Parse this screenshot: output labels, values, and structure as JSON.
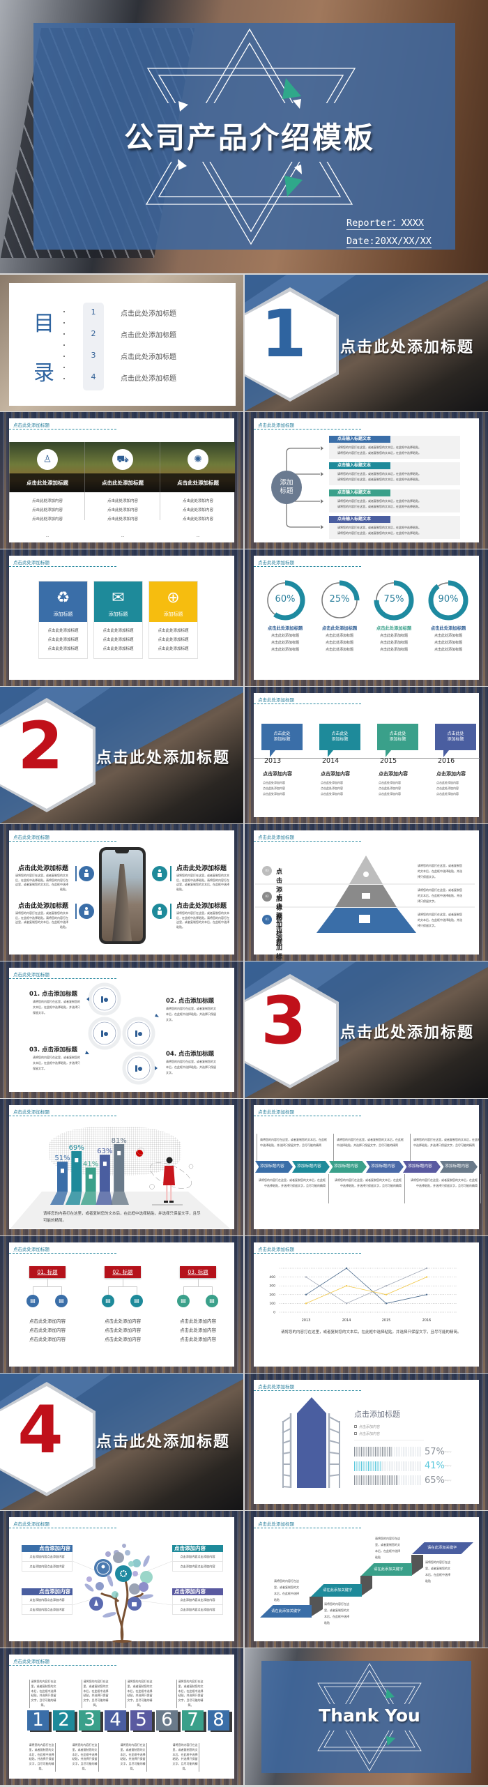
{
  "colors": {
    "blue": "#3a6ea8",
    "teal": "#1e8a9a",
    "green": "#3aa08a",
    "indigo": "#4a5ea0",
    "violet": "#5a5aa0",
    "slate": "#6a7a8a",
    "yellow": "#f6bd0f",
    "red": "#b5121b",
    "header": "#2a7f9c"
  },
  "cover": {
    "title": "公司产品介绍模板",
    "reporter": "Reporter：XXXX",
    "date": "Date:20XX/XX/XX"
  },
  "common": {
    "header": "点击此处添加标题"
  },
  "toc": {
    "char_1": "目",
    "char_2": "录",
    "items": [
      {
        "num": "1",
        "label": "点击此处添加标题"
      },
      {
        "num": "2",
        "label": "点击此处添加标题"
      },
      {
        "num": "3",
        "label": "点击此处添加标题"
      },
      {
        "num": "4",
        "label": "点击此处添加标题"
      }
    ]
  },
  "sections": [
    {
      "num": "1",
      "title": "点击此处添加标题",
      "color": "#2f64a0"
    },
    {
      "num": "2",
      "title": "点击此处添加标题",
      "color": "#c0101a"
    },
    {
      "num": "3",
      "title": "点击此处添加标题",
      "color": "#c0101a"
    },
    {
      "num": "4",
      "title": "点击此处添加标题",
      "color": "#c0101a"
    }
  ],
  "features": {
    "columns": [
      {
        "icon": "person-globe-icon",
        "glyph": "♙",
        "title": "点击此处添加标题",
        "lines": [
          "点击此处添加内容",
          "点击此处添加内容",
          "点击此处添加内容"
        ],
        "more": "..."
      },
      {
        "icon": "car-icon",
        "glyph": "⛟",
        "title": "点击此处添加标题",
        "lines": [
          "点击此处添加内容",
          "点击此处添加内容",
          "点击此处添加内容"
        ],
        "more": "..."
      },
      {
        "icon": "network-icon",
        "glyph": "✺",
        "title": "点击此处添加标题",
        "lines": [
          "点击此处添加内容",
          "点击此处添加内容",
          "点击此处添加内容"
        ],
        "more": "..."
      }
    ]
  },
  "branch": {
    "center_1": "添加",
    "center_2": "标题",
    "items": [
      {
        "title": "点击输入标题文本",
        "color": "#3a6ea8",
        "lines": [
          "请将您的内容打在这里，或者复制您的文本后，在此框中选择粘贴。",
          "请将您的内容打在这里，或者复制您的文本后，在此框中选择粘贴。"
        ]
      },
      {
        "title": "点击输入标题文本",
        "color": "#1e8a9a",
        "lines": [
          "请将您的内容打在这里，或者复制您的文本后，在此框中选择粘贴。",
          "请将您的内容打在这里，或者复制您的文本后，在此框中选择粘贴。"
        ]
      },
      {
        "title": "点击输入标题文本",
        "color": "#3aa08a",
        "lines": [
          "请将您的内容打在这里，或者复制您的文本后，在此框中选择粘贴。",
          "请将您的内容打在这里，或者复制您的文本后，在此框中选择粘贴。"
        ]
      },
      {
        "title": "点击输入标题文本",
        "color": "#4a5ea0",
        "lines": [
          "请将您的内容打在这里，或者复制您的文本后，在此框中选择粘贴。",
          "请将您的内容打在这里，或者复制您的文本后，在此框中选择粘贴。"
        ]
      }
    ]
  },
  "cards": [
    {
      "label": "添加标题",
      "icon": "recycle-icon",
      "glyph": "♻",
      "color": "#3a6ea8",
      "lines": [
        "点击此处添加标题",
        "点击此处添加标题",
        "点击此处添加标题"
      ]
    },
    {
      "label": "添加标题",
      "icon": "mail-icon",
      "glyph": "✉",
      "color": "#1e8a9a",
      "lines": [
        "点击此处添加标题",
        "点击此处添加标题",
        "点击此处添加标题"
      ]
    },
    {
      "label": "添加标题",
      "icon": "globe-icon",
      "glyph": "⊕",
      "color": "#f6bd0f",
      "lines": [
        "点击此处添加标题",
        "点击此处添加标题",
        "点击此处添加标题"
      ]
    }
  ],
  "rings": [
    {
      "value": 60,
      "label": "60%",
      "title": "点击此处添加标题",
      "title_color": "#2f5e94",
      "lines": [
        "点击此处添加标题",
        "点击此处添加标题",
        "点击此处添加标题"
      ]
    },
    {
      "value": 25,
      "label": "25%",
      "title": "点击此处添加标题",
      "title_color": "#2f5e94",
      "lines": [
        "点击此处添加标题",
        "点击此处添加标题",
        "点击此处添加标题"
      ]
    },
    {
      "value": 75,
      "label": "75%",
      "title": "点击此处添加标题",
      "title_color": "#3aa08a",
      "lines": [
        "点击此处添加标题",
        "点击此处添加标题",
        "点击此处添加标题"
      ]
    },
    {
      "value": 90,
      "label": "90%",
      "title": "点击此处添加标题",
      "title_color": "#2f5e94",
      "lines": [
        "点击此处添加标题",
        "点击此处添加标题",
        "点击此处添加标题"
      ]
    }
  ],
  "timeline": [
    {
      "box_1": "点击此处",
      "box_2": "添加标题",
      "year": "2013",
      "title": "点击添加内容",
      "color": "#3a6ea8",
      "lines": [
        "点击此处添加内容",
        "点击此处添加内容",
        "点击此处添加内容"
      ]
    },
    {
      "box_1": "点击此处",
      "box_2": "添加标题",
      "year": "2014",
      "title": "点击添加内容",
      "color": "#1e8a9a",
      "lines": [
        "点击此处添加内容",
        "点击此处添加内容",
        "点击此处添加内容"
      ]
    },
    {
      "box_1": "点击此处",
      "box_2": "添加标题",
      "year": "2015",
      "title": "点击添加内容",
      "color": "#3aa08a",
      "lines": [
        "点击此处添加内容",
        "点击此处添加内容",
        "点击此处添加内容"
      ]
    },
    {
      "box_1": "点击此处",
      "box_2": "添加标题",
      "year": "2016",
      "title": "点击添加内容",
      "color": "#4a5ea0",
      "lines": [
        "点击此处添加内容",
        "点击此处添加内容",
        "点击此处添加内容"
      ]
    }
  ],
  "phone": {
    "items": [
      {
        "title": "点击此处添加标题",
        "text": "请将您的内容打在这里，或者复制您的文本后，在此框中选择粘贴。请将您的内容打在这里，或者复制您的文本后，在此框中选择粘贴。"
      },
      {
        "title": "点击此处添加标题",
        "text": "请将您的内容打在这里，或者复制您的文本后，在此框中选择粘贴。请将您的内容打在这里，或者复制您的文本后，在此框中选择粘贴。"
      },
      {
        "title": "点击此处添加标题",
        "text": "请将您的内容打在这里，或者复制您的文本后，在此框中选择粘贴。请将您的内容打在这里，或者复制您的文本后，在此框中选择粘贴。"
      },
      {
        "title": "点击此处添加标题",
        "text": "请将您的内容打在这里，或者复制您的文本后，在此框中选择粘贴。请将您的内容打在这里，或者复制您的文本后，在此框中选择粘贴。"
      }
    ]
  },
  "pyramid": {
    "items": [
      {
        "num": "03",
        "title": "点击添加标题",
        "color": "#bdbdbd",
        "text": "请将您的内容打在这里，或者复制您的文本后，在此框中选择粘贴，并选择只保留文字。"
      },
      {
        "num": "02",
        "title": "点击添加标题",
        "color": "#8a8a8a",
        "text": "请将您的内容打在这里，或者复制您的文本后，在此框中选择粘贴，并选择只保留文字。"
      },
      {
        "num": "01",
        "title": "点击添加标题",
        "color": "#3a6ea8",
        "text": "请将您的内容打在这里，或者复制您的文本后，在此框中选择粘贴，并选择只保留文字。"
      }
    ]
  },
  "circles": {
    "items": [
      {
        "title": "01. 点击添加标题",
        "text": "请将您的内容打在这里，或者复制您的文本后，在此框中选择粘贴，并选择只保留文字。"
      },
      {
        "title": "02. 点击添加标题",
        "text": "请将您的内容打在这里，或者复制您的文本后，在此框中选择粘贴，并选择只保留文字。"
      },
      {
        "title": "03. 点击添加标题",
        "text": "请将您的内容打在这里，或者复制您的文本后，在此框中选择粘贴，并选择只保留文字。"
      },
      {
        "title": "04. 点击添加标题",
        "text": "请将您的内容打在这里，或者复制您的文本后，在此框中选择粘贴，并选择只保留文字。"
      }
    ]
  },
  "bars_slide": {
    "text": "请将您的内容打在这里，或者复制您的文本后，在此框中选择粘贴，并选择只保留文字，且尽可能的精简。"
  },
  "process": {
    "steps": [
      {
        "label": "添加标题内容",
        "color": "#3a6ea8"
      },
      {
        "label": "添加标题内容",
        "color": "#1e8a9a"
      },
      {
        "label": "添加标题内容",
        "color": "#3aa08a"
      },
      {
        "label": "添加标题内容",
        "color": "#4a6aa8"
      },
      {
        "label": "添加标题内容",
        "color": "#5a5aa0"
      },
      {
        "label": "添加标题内容",
        "color": "#6a7a8a"
      }
    ],
    "upper": [
      "请将您的内容打在这里，或者复制您的文本后，在此框中选择粘贴，并选择只保留文字，且尽可能的精简",
      "请将您的内容打在这里，或者复制您的文本后，在此框中选择粘贴，并选择只保留文字，且尽可能的精简",
      "请将您的内容打在这里，或者复制您的文本后，在此框中选择粘贴，并选择只保留文字，且尽可能的精简"
    ],
    "lower": [
      "请将您的内容打在这里，或者复制您的文本后，在此框中选择粘贴，并选择只保留文字，且尽可能的精简",
      "请将您的内容打在这里，或者复制您的文本后，在此框中选择粘贴，并选择只保留文字，且尽可能的精简",
      "请将您的内容打在这里，或者复制您的文本后，在此框中选择粘贴，并选择只保留文字，且尽可能的精简"
    ]
  },
  "org": {
    "groups": [
      {
        "label": "01. 标题",
        "color": "#3a6ea8",
        "lines": [
          "点击此处添加内容",
          "点击此处添加内容",
          "点击此处添加内容"
        ]
      },
      {
        "label": "02. 标题",
        "color": "#1e8a9a",
        "lines": [
          "点击此处添加内容",
          "点击此处添加内容",
          "点击此处添加内容"
        ]
      },
      {
        "label": "03. 标题",
        "color": "#3aa08a",
        "lines": [
          "点击此处添加内容",
          "点击此处添加内容",
          "点击此处添加内容"
        ]
      }
    ]
  },
  "line_slide": {
    "text": "请将您的内容打在这里，或者复制您的文本后，在此框中选择粘贴，并选择只保留文字，且尽可能的精简。"
  },
  "building": {
    "title": "点击添加标题",
    "bullets": [
      "点击添加内容",
      "点击添加内容"
    ]
  },
  "tree": {
    "boxes": [
      {
        "title": "点击添加内容",
        "color": "#3a6ea8",
        "lines": [
          "点击添加内容点击添加内容",
          "点击添加内容点击添加内容"
        ]
      },
      {
        "title": "点击添加内容",
        "color": "#1e8a9a",
        "lines": [
          "点击添加内容点击添加内容",
          "点击添加内容点击添加内容"
        ]
      },
      {
        "title": "点击添加内容",
        "color": "#4a5ea0",
        "lines": [
          "点击添加内容点击添加内容",
          "点击添加内容点击添加内容"
        ]
      },
      {
        "title": "点击添加内容",
        "color": "#5a5aa0",
        "lines": [
          "点击添加内容点击添加内容",
          "点击添加内容点击添加内容"
        ]
      }
    ]
  },
  "stairs": {
    "steps": [
      {
        "label": "请在此添加关键字",
        "color": "#3a6ea8",
        "text": "请将您的内容打在这里，或者复制您的文本后，在此框中选择粘贴"
      },
      {
        "label": "请在此添加关键字",
        "color": "#1e8a9a",
        "text": "请将您的内容打在这里，或者复制您的文本后，在此框中选择粘贴"
      },
      {
        "label": "请在此添加关键字",
        "color": "#3aa08a",
        "text": "请将您的内容打在这里，或者复制您的文本后，在此框中选择粘贴"
      },
      {
        "label": "请在此添加关键字",
        "color": "#4a5ea0",
        "text": "请将您的内容打在这里，或者复制您的文本后，在此框中选择粘贴"
      }
    ]
  },
  "numbers": {
    "text": "请将您的内容打在这里，或者复制您的文本后，在此框中选择粘贴，并选择只保留文字，且尽可能的精简。",
    "items": [
      {
        "num": "1",
        "color": "#3a6ea8"
      },
      {
        "num": "2",
        "color": "#1e8a9a"
      },
      {
        "num": "3",
        "color": "#3aa08a"
      },
      {
        "num": "4",
        "color": "#4a5ea0"
      },
      {
        "num": "5",
        "color": "#5a5aa0"
      },
      {
        "num": "6",
        "color": "#6a7a8a"
      },
      {
        "num": "7",
        "color": "#3aa08a"
      },
      {
        "num": "8",
        "color": "#3a6ea8"
      }
    ]
  },
  "thanks": {
    "title": "Thank You"
  },
  "chart_data": [
    {
      "type": "bar",
      "values": [
        51,
        69,
        41,
        63,
        81
      ],
      "labels": [
        "51%",
        "69%",
        "41%",
        "63%",
        "81%"
      ],
      "colors": [
        "#3a6ea8",
        "#1e8a9a",
        "#3aa08a",
        "#4a5ea0",
        "#6a7a8a"
      ],
      "ylim": [
        0,
        100
      ],
      "grid": false
    },
    {
      "type": "line",
      "x": [
        "2013",
        "2014",
        "2015",
        "2016"
      ],
      "yticks": [
        "0",
        "100",
        "200",
        "300",
        "400"
      ],
      "ylim": [
        0,
        500
      ],
      "grid": true,
      "series": [
        {
          "values": [
            400,
            100,
            300,
            500
          ],
          "color": "#a3aab8"
        },
        {
          "values": [
            200,
            500,
            100,
            200
          ],
          "color": "#4a6a8c"
        },
        {
          "values": [
            100,
            300,
            200,
            400
          ],
          "color": "#f2c94c"
        }
      ]
    },
    {
      "type": "bar",
      "orientation": "horizontal",
      "values": [
        57,
        41,
        65
      ],
      "labels": [
        "57%",
        "41%",
        "65%"
      ],
      "categories": [
        "Category",
        "Category",
        "Category"
      ],
      "colors": [
        "#8a9098",
        "#5cc8dc",
        "#8a9098"
      ],
      "xlim": [
        0,
        100
      ]
    }
  ]
}
